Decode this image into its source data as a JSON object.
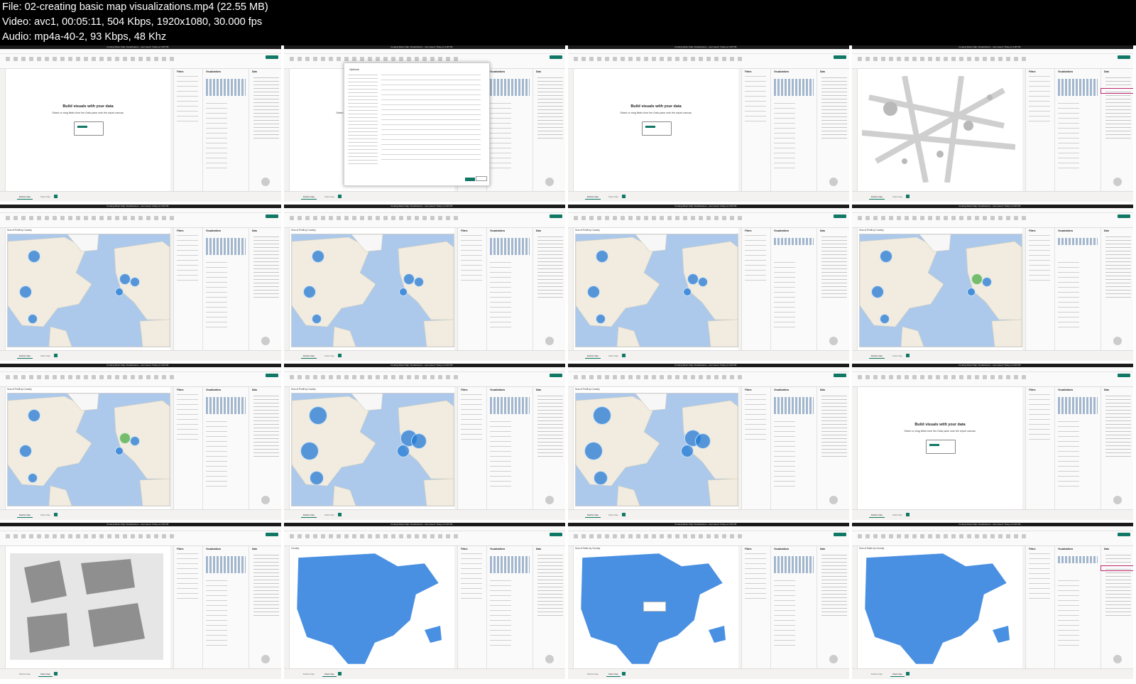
{
  "header": {
    "file_line": "File: 02-creating basic map visualizations.mp4 (22.55 MB)",
    "video_line": "Video: avc1, 00:05:11, 504 Kbps, 1920x1080, 30.000 fps",
    "audio_line": "Audio: mp4a-40-2, 93 Kbps, 48 Khz"
  },
  "app": {
    "window_title": "Creating Basic Map Visualizations - Last saved: Today at 3:48 PM",
    "menu": [
      "File",
      "Home",
      "Insert",
      "Modeling",
      "View",
      "Optimize",
      "Help",
      "Format",
      "Data / Drill"
    ],
    "panes": {
      "filters": "Filters",
      "visualizations": "Visualizations",
      "data": "Data",
      "options": "Options"
    },
    "page_tabs": [
      "Bubble Map",
      "Filled Map"
    ],
    "visual_titles": {
      "bubble": "Sum of Profit by Country",
      "filled": "Country",
      "sales": "Sum of Sales by Country"
    },
    "empty_state": {
      "title": "Build visuals with your data",
      "subtitle": "Select or drag fields from the Data pane onto the report canvas."
    }
  },
  "colors": {
    "background": "#000000",
    "header_text": "#ffffff",
    "accent": "#117865",
    "bubble_blue": "#2179d6",
    "bubble_green": "#5fb559",
    "highlight": "#c0286f",
    "map_ocean": "#acc9eb",
    "map_land": "#f1ecdf",
    "filled_region": "#4a90e2"
  },
  "icons": [
    "publish-icon",
    "plus-icon",
    "zoom-icon",
    "map-icon"
  ]
}
